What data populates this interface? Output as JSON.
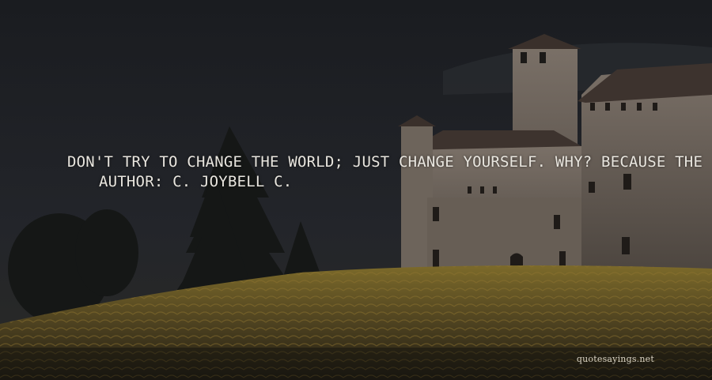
{
  "quote": {
    "line1": "DON'T TRY TO CHANGE THE WORLD; JUST CHANGE YOURSELF. WHY? BECAUSE THE",
    "author": "AUTHOR: C. JOYBELL C."
  },
  "watermark": "quotesayings.net",
  "colors": {
    "sky": "#1b1d21",
    "castle": "#6f665d",
    "vineyard": "#6a5a22",
    "text": "#e9e6df"
  }
}
